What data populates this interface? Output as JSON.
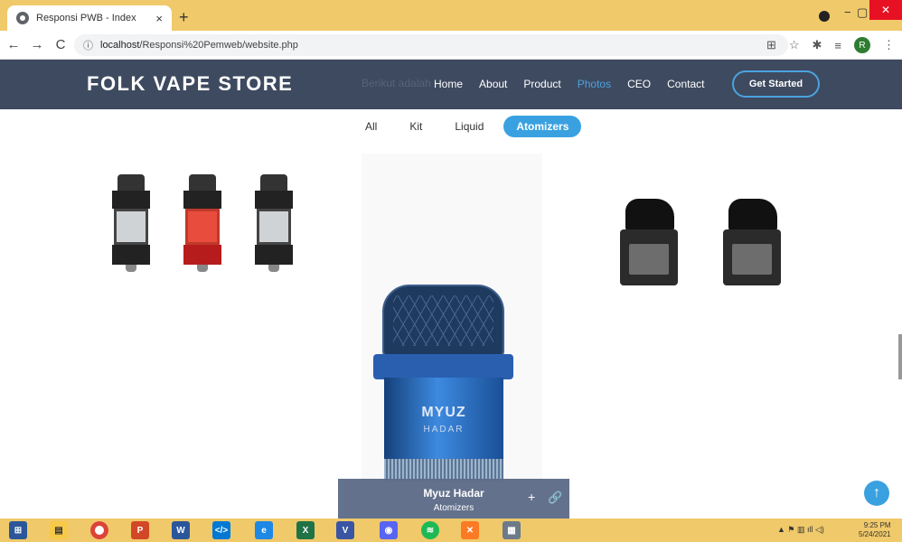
{
  "browser": {
    "tab_title": "Responsi PWB - Index",
    "tab_close": "×",
    "new_tab": "+",
    "minimize": "−",
    "maximize": "▢",
    "close": "✕",
    "back": "←",
    "forward": "→",
    "reload": "C",
    "info": "ⓘ",
    "url_host": "localhost",
    "url_path": "/Responsi%20Pemweb/website.php",
    "profile_initial": "R"
  },
  "site": {
    "logo": "FOLK VAPE STORE",
    "ghost_text": "Berikut adalah",
    "nav": [
      "Home",
      "About",
      "Product",
      "Photos",
      "CEO",
      "Contact"
    ],
    "nav_active": "Photos",
    "cta": "Get Started",
    "cta_color": "#4aa3df",
    "header_color": "#3e4a60"
  },
  "filters": {
    "items": [
      "All",
      "Kit",
      "Liquid",
      "Atomizers"
    ],
    "active": "Atomizers"
  },
  "featured": {
    "brand": "MYUZ",
    "brand_sub": "HADAR",
    "name": "Myuz Hadar",
    "category": "Atomizers",
    "action_add": "+",
    "action_link": "🔗"
  },
  "scroll_top": "↑",
  "taskbar": {
    "apps": [
      "start",
      "file-explorer",
      "chrome",
      "powerpoint",
      "word",
      "vscode",
      "edge",
      "excel",
      "visio",
      "discord",
      "spotify",
      "xampp",
      "network"
    ],
    "time": "9:25 PM",
    "date": "5/24/2021"
  }
}
